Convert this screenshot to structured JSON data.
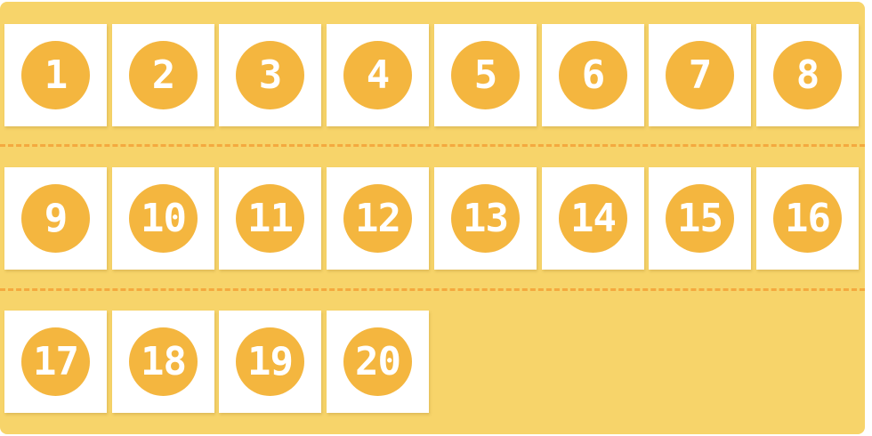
{
  "tiles": [
    "1",
    "2",
    "3",
    "4",
    "5",
    "6",
    "7",
    "8",
    "9",
    "10",
    "11",
    "12",
    "13",
    "14",
    "15",
    "16",
    "17",
    "18",
    "19",
    "20"
  ],
  "colors": {
    "background": "#f7d46a",
    "badge": "#f4b63f",
    "divider": "#f4a93f",
    "tile": "#ffffff"
  }
}
